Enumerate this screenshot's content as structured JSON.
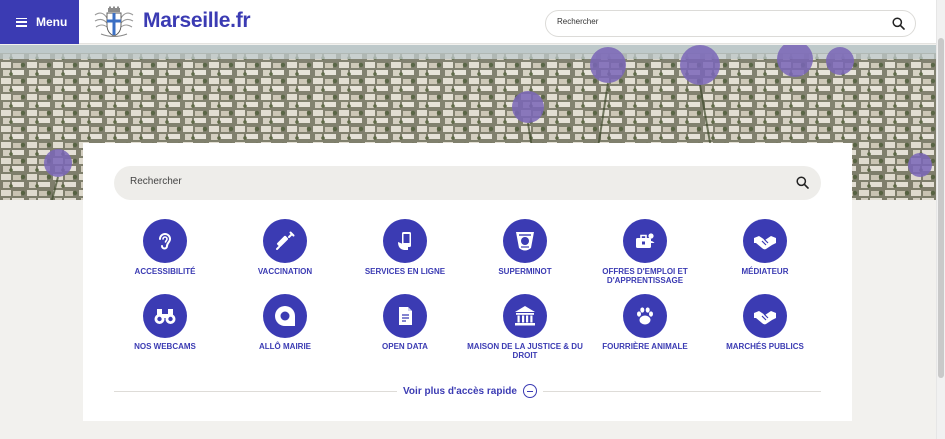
{
  "header": {
    "menu_label": "Menu",
    "brand": "Marseille.fr",
    "search_placeholder": "Rechercher"
  },
  "main": {
    "search_placeholder": "Rechercher",
    "quick_access": [
      {
        "label": "ACCESSIBILITÉ",
        "icon": "ear-icon"
      },
      {
        "label": "VACCINATION",
        "icon": "syringe-icon"
      },
      {
        "label": "SERVICES EN LIGNE",
        "icon": "phone-hand-icon"
      },
      {
        "label": "SUPERMINOT",
        "icon": "superminot-icon"
      },
      {
        "label": "OFFRES D'EMPLOI ET D'APPRENTISSAGE",
        "icon": "job-offers-icon"
      },
      {
        "label": "MÉDIATEUR",
        "icon": "handshake-icon"
      },
      {
        "label": "NOS WEBCAMS",
        "icon": "binoculars-icon"
      },
      {
        "label": "ALLÔ MAIRIE",
        "icon": "speech-bubble-icon"
      },
      {
        "label": "OPEN DATA",
        "icon": "open-data-icon"
      },
      {
        "label": "MAISON DE LA JUSTICE & DU DROIT",
        "icon": "courthouse-icon"
      },
      {
        "label": "FOURRIÈRE ANIMALE",
        "icon": "paw-icon"
      },
      {
        "label": "MARCHÉS PUBLICS",
        "icon": "handshake-icon"
      }
    ],
    "more_label": "Voir plus d'accès rapide"
  },
  "colors": {
    "brand": "#3b3bb3",
    "background": "#f2f1ee"
  }
}
